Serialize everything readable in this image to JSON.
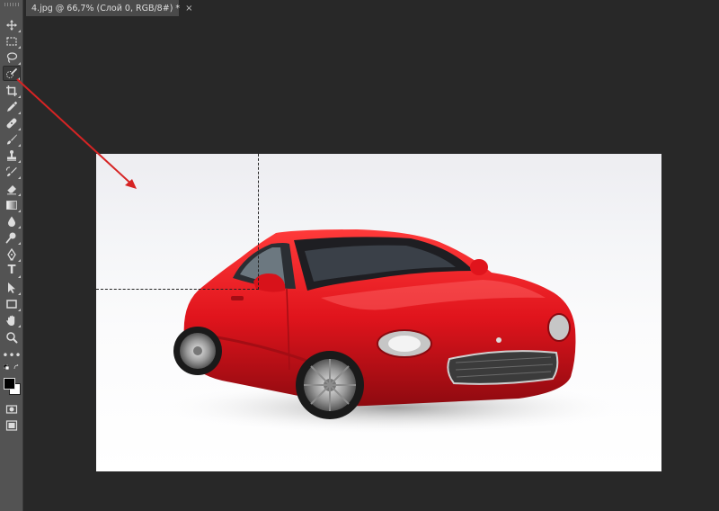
{
  "document": {
    "tab_title": "4.jpg @ 66,7% (Слой 0, RGB/8#) *",
    "close_glyph": "×",
    "image_subject": "red-sports-car-photo"
  },
  "toolbar": {
    "active_tool": "quick-selection-tool",
    "type_tool_glyph": "T",
    "more_tools_glyph": "•••"
  },
  "colors": {
    "foreground": "#000000",
    "background": "#ffffff",
    "annotation_arrow": "#d62424",
    "car_body": "#e0141c"
  },
  "annotation": {
    "type": "arrow",
    "points_to": "quick-selection-tool"
  }
}
